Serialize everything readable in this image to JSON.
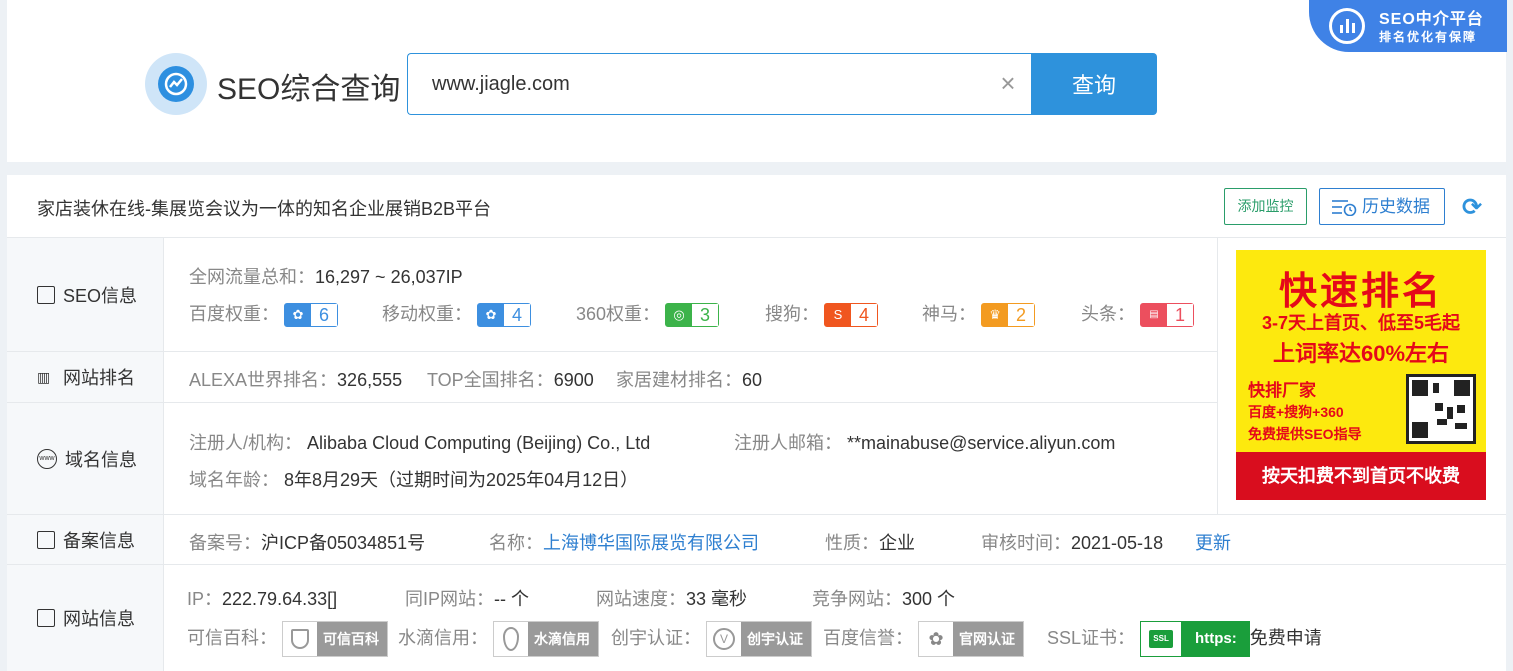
{
  "corner_badge": {
    "title": "SEO中介平台",
    "subtitle": "排名优化有保障"
  },
  "header": {
    "title": "SEO综合查询"
  },
  "search": {
    "value": "www.jiagle.com",
    "button": "查询"
  },
  "site": {
    "title": "家店装休在线-集展览会议为一体的知名企业展销B2B平台"
  },
  "toolbar": {
    "monitor": "添加监控",
    "history": "历史数据"
  },
  "seo_info": {
    "label": "SEO信息",
    "traffic_label": "全网流量总和：",
    "traffic_value": "16,297 ~ 26,037IP",
    "weights": [
      {
        "label": "百度权重：",
        "value": "6",
        "color": "#3d8fe0",
        "icon": "paw-icon"
      },
      {
        "label": "移动权重：",
        "value": "4",
        "color": "#3d8fe0",
        "icon": "paw-icon"
      },
      {
        "label": "360权重：",
        "value": "3",
        "color": "#3cb34a",
        "icon": "q360-icon"
      },
      {
        "label": "搜狗：",
        "value": "4",
        "color": "#f0561f",
        "icon": "sogou-icon"
      },
      {
        "label": "神马：",
        "value": "2",
        "color": "#f39b21",
        "icon": "shenma-icon"
      },
      {
        "label": "头条：",
        "value": "1",
        "color": "#ec4f5e",
        "icon": "toutiao-icon"
      }
    ]
  },
  "ranking": {
    "label": "网站排名",
    "alexa_label": "ALEXA世界排名：",
    "alexa_value": "326,555",
    "top_label": "TOP全国排名：",
    "top_value": "6900",
    "cat_label": "家居建材排名：",
    "cat_value": "60"
  },
  "domain": {
    "label": "域名信息",
    "registrant_label": "注册人/机构：",
    "registrant_value": "Alibaba Cloud Computing (Beijing) Co., Ltd",
    "email_label": "注册人邮箱：",
    "email_value": "**mainabuse@service.aliyun.com",
    "age_label": "域名年龄：",
    "age_value": "8年8月29天（过期时间为2025年04月12日）"
  },
  "icp": {
    "label": "备案信息",
    "num_label": "备案号：",
    "num_value": "沪ICP备05034851号",
    "name_label": "名称：",
    "name_value": "上海博华国际展览有限公司",
    "type_label": "性质：",
    "type_value": "企业",
    "time_label": "审核时间：",
    "time_value": "2021-05-18",
    "update": "更新"
  },
  "site_info": {
    "label": "网站信息",
    "ip_label": "IP：",
    "ip_value": "222.79.64.33[]",
    "sameip_label": "同IP网站：",
    "sameip_value": "-- 个",
    "speed_label": "网站速度：",
    "speed_value": "33 毫秒",
    "compete_label": "竞争网站：",
    "compete_value": "300 个",
    "certs": [
      {
        "label": "可信百科：",
        "badge": "可信百科",
        "icon": "shield-icon"
      },
      {
        "label": "水滴信用：",
        "badge": "水滴信用",
        "icon": "water-drop-icon"
      },
      {
        "label": "创宇认证：",
        "badge": "创宇认证",
        "icon": "v-icon"
      },
      {
        "label": "百度信誉：",
        "badge": "官网认证",
        "icon": "paw-icon"
      }
    ],
    "ssl_label": "SSL证书：",
    "ssl_badge": "https:",
    "ssl_icon_text": "SSL",
    "ssl_link": "免费申请"
  },
  "ad": {
    "line1": "快速排名",
    "line2": "3-7天上首页、低至5毛起",
    "line3": "上词率达60%左右",
    "line4": "快排厂家",
    "line5": "百度+搜狗+360",
    "line6": "免费提供SEO指导",
    "line7": "按天扣费不到首页不收费"
  }
}
